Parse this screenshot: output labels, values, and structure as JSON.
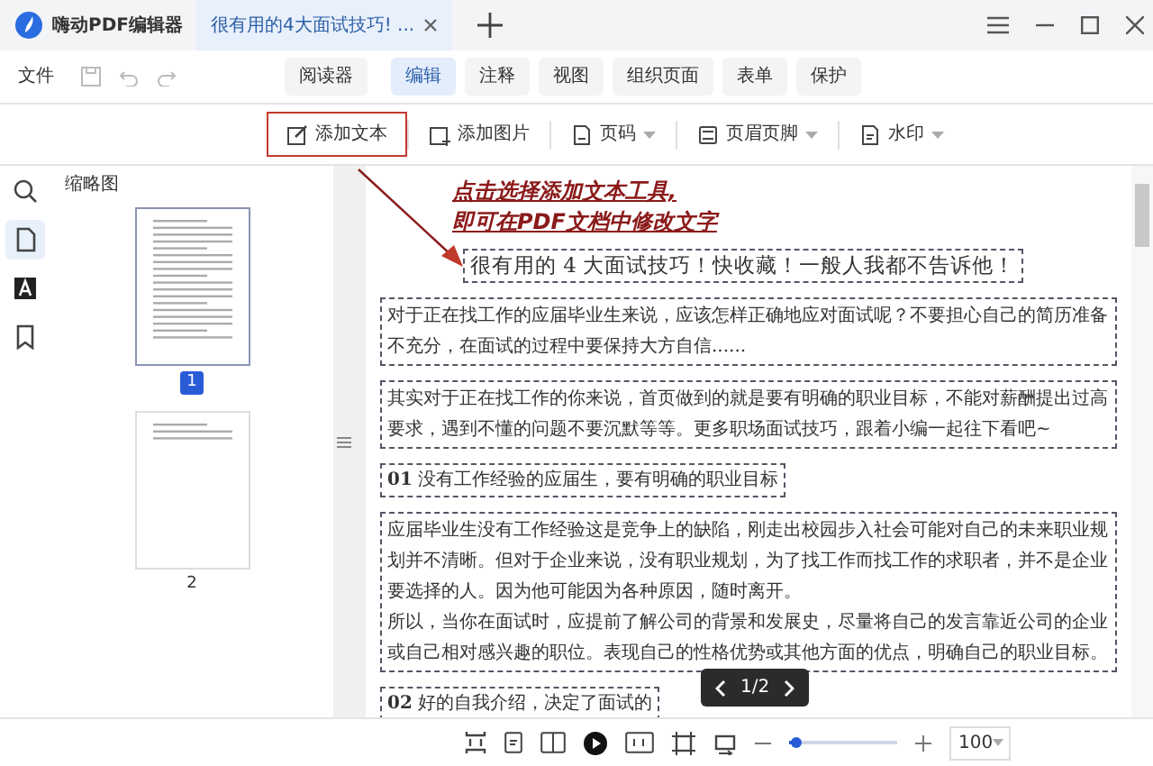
{
  "app": {
    "title": "嗨动PDF编辑器"
  },
  "doc_tabs": [
    {
      "label": "很有用的4大面试技巧! ...",
      "selected": true
    }
  ],
  "menu": {
    "file": "文件"
  },
  "ribbon_tabs": [
    {
      "label": "阅读器",
      "selected": false
    },
    {
      "label": "编辑",
      "selected": true
    },
    {
      "label": "注释",
      "selected": false
    },
    {
      "label": "视图",
      "selected": false
    },
    {
      "label": "组织页面",
      "selected": false
    },
    {
      "label": "表单",
      "selected": false
    },
    {
      "label": "保护",
      "selected": false
    }
  ],
  "tools": [
    {
      "kind": "text",
      "label": "添加文本",
      "highlighted": true
    },
    {
      "kind": "image",
      "label": "添加图片",
      "highlighted": false
    },
    {
      "kind": "pagenum",
      "label": "页码",
      "highlighted": false
    },
    {
      "kind": "headerfooter",
      "label": "页眉页脚",
      "highlighted": false
    },
    {
      "kind": "watermark",
      "label": "水印",
      "highlighted": false
    }
  ],
  "sidebar": {
    "icons": [
      {
        "kind": "search",
        "selected": false
      },
      {
        "kind": "pages",
        "selected": true
      },
      {
        "kind": "text",
        "selected": false
      },
      {
        "kind": "bookmark",
        "selected": false
      }
    ],
    "panel_title": "缩略图",
    "thumbnails": [
      {
        "label": "1",
        "selected": true,
        "kind": "full"
      },
      {
        "label": "2",
        "selected": false,
        "kind": "short"
      }
    ]
  },
  "annotation": {
    "lines": [
      "点击选择添加文本工具,",
      "即可在PDF文档中修改文字"
    ]
  },
  "document": {
    "blocks": [
      {
        "kind": "title",
        "paragraphs": [
          "很有用的 4 大面试技巧！快收藏！一般人我都不告诉他！"
        ]
      },
      {
        "kind": "paragraph",
        "paragraphs": [
          "对于正在找工作的应届毕业生来说，应该怎样正确地应对面试呢？不要担心自己的简历准备不充分，在面试的过程中要保持大方自信......"
        ]
      },
      {
        "kind": "paragraph",
        "paragraphs": [
          "其实对于正在找工作的你来说，首页做到的就是要有明确的职业目标，不能对薪酬提出过高要求，遇到不懂的问题不要沉默等等。更多职场面试技巧，跟着小编一起往下看吧~"
        ]
      },
      {
        "kind": "heading",
        "paragraphs": [
          "**01** 没有工作经验的应届生，要有明确的职业目标"
        ]
      },
      {
        "kind": "paragraph",
        "paragraphs": [
          "应届毕业生没有工作经验这是竞争上的缺陷，刚走出校园步入社会可能对自己的未来职业规划并不清晰。但对于企业来说，没有职业规划，为了找工作而找工作的求职者，并不是企业要选择的人。因为他可能因为各种原因，随时离开。",
          "所以，当你在面试时，应提前了解公司的背景和发展史，尽量将自己的发言靠近公司的企业或自己相对感兴趣的职位。表现自己的性格优势或其他方面的优点，明确自己的职业目标。"
        ]
      },
      {
        "kind": "heading",
        "paragraphs": [
          "**02** 好的自我介绍，决定了面试的"
        ]
      }
    ]
  },
  "page_nav": {
    "label": "1/2"
  },
  "zoom": {
    "level": 0.06,
    "value": "100"
  }
}
